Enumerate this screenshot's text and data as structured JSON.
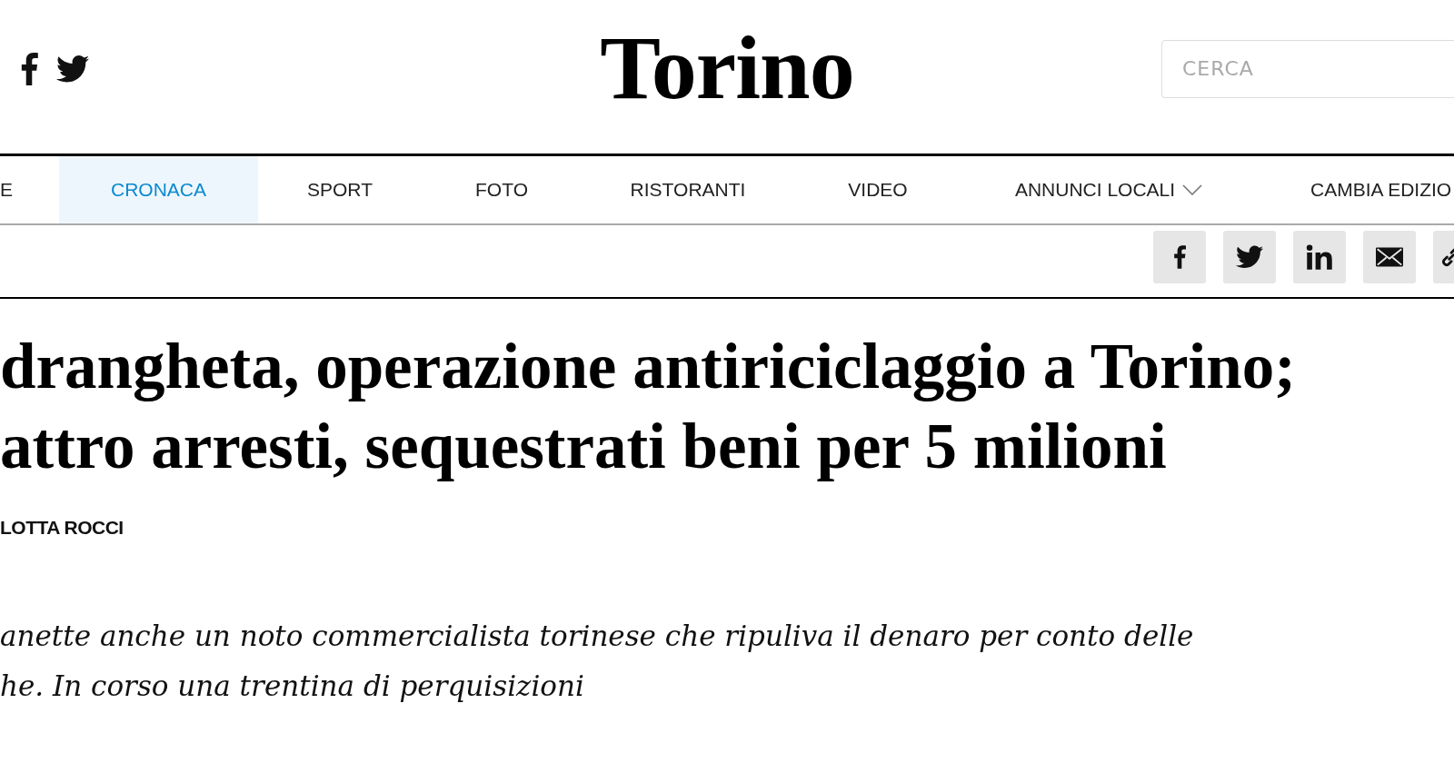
{
  "header": {
    "social_links": [
      {
        "kind": "facebook"
      },
      {
        "kind": "twitter"
      }
    ],
    "logo": "Torino",
    "search": {
      "placeholder": "CERCA"
    }
  },
  "nav": [
    {
      "label": "E",
      "selected": false,
      "has_menu": false
    },
    {
      "label": "CRONACA",
      "selected": true,
      "has_menu": false
    },
    {
      "label": "SPORT",
      "selected": false,
      "has_menu": false
    },
    {
      "label": "FOTO",
      "selected": false,
      "has_menu": false
    },
    {
      "label": "RISTORANTI",
      "selected": false,
      "has_menu": false
    },
    {
      "label": "VIDEO",
      "selected": false,
      "has_menu": false
    },
    {
      "label": "ANNUNCI LOCALI",
      "selected": false,
      "has_menu": true
    },
    {
      "label": "CAMBIA EDIZIO",
      "selected": false,
      "has_menu": false
    }
  ],
  "share_buttons": [
    {
      "kind": "facebook"
    },
    {
      "kind": "twitter"
    },
    {
      "kind": "linkedin"
    },
    {
      "kind": "email"
    },
    {
      "kind": "link"
    }
  ],
  "article": {
    "headline_lines": [
      "drangheta, operazione antiriciclaggio a Torino;",
      "attro arresti, sequestrati beni per 5 milioni"
    ],
    "byline": "LOTTA ROCCI",
    "summary_lines": [
      "anette anche un noto commercialista torinese che ripuliva il denaro per conto delle",
      "he. In corso una trentina di perquisizioni"
    ]
  }
}
